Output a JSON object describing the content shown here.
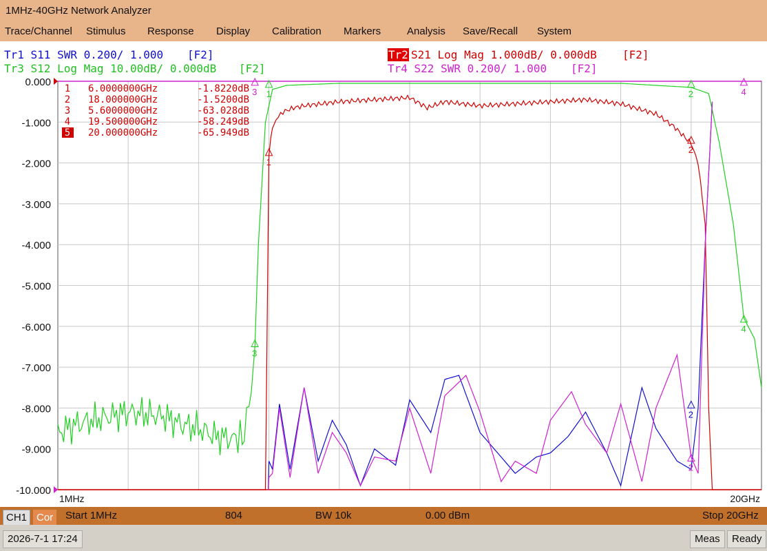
{
  "window": {
    "title": "1MHz-40GHz Network Analyzer"
  },
  "menu": [
    "Trace/Channel",
    "Stimulus",
    "Response",
    "Display",
    "Calibration",
    "Markers",
    "Analysis",
    "Save/Recall",
    "System"
  ],
  "traces": {
    "tr1": {
      "label": "Tr1 S11 SWR 0.200/ 1.000",
      "tag": "[F2]",
      "color": "#1010d0"
    },
    "tr2": {
      "name": "Tr2",
      "label": "S21 Log Mag 1.000dB/ 0.000dB",
      "tag": "[F2]",
      "color": "#d00000"
    },
    "tr3": {
      "label": "Tr3 S12 Log Mag 10.00dB/ 0.000dB",
      "tag": "[F2]",
      "color": "#20d020"
    },
    "tr4": {
      "label": "Tr4 S22 SWR 0.200/ 1.000",
      "tag": "[F2]",
      "color": "#d020d0"
    }
  },
  "markers": [
    {
      "num": "1",
      "freq": "6.0000000GHz",
      "value": "-1.8220dB"
    },
    {
      "num": "2",
      "freq": "18.000000GHz",
      "value": "-1.5200dB"
    },
    {
      "num": "3",
      "freq": "5.6000000GHz",
      "value": "-63.028dB"
    },
    {
      "num": "4",
      "freq": "19.500000GHz",
      "value": "-58.249dB"
    },
    {
      "num": "5",
      "freq": "20.000000GHz",
      "value": "-65.949dB",
      "active": true
    }
  ],
  "chart_data": {
    "type": "line",
    "y_axis_labels": [
      "0.000",
      "-1.000",
      "-2.000",
      "-3.000",
      "-4.000",
      "-5.000",
      "-6.000",
      "-7.000",
      "-8.000",
      "-9.000",
      "-10.000"
    ],
    "ylim": [
      -10,
      0
    ],
    "x_start_label": "1MHz",
    "x_stop_label": "20GHz",
    "xlim_ghz": [
      0.001,
      20
    ],
    "grid": true,
    "series": [
      {
        "name": "Tr2 S21",
        "color": "#d00000",
        "x": [
          0,
          5.9,
          5.95,
          6.0,
          6.05,
          6.1,
          6.2,
          6.4,
          6.7,
          7.0,
          8.0,
          9.0,
          10.0,
          10.5,
          11.0,
          12.0,
          13.0,
          14.0,
          15.0,
          16.0,
          17.0,
          17.5,
          18.0,
          18.2,
          18.4,
          18.5,
          18.6,
          20
        ],
        "y": [
          -10,
          -10,
          -6,
          -1.82,
          -1.4,
          -1.15,
          -0.95,
          -0.75,
          -0.65,
          -0.6,
          -0.5,
          -0.45,
          -0.4,
          -0.65,
          -0.5,
          -0.6,
          -0.55,
          -0.5,
          -0.45,
          -0.55,
          -0.8,
          -1.1,
          -1.52,
          -2.0,
          -3.5,
          -8.0,
          -10,
          -10
        ]
      },
      {
        "name": "Tr3 S12",
        "color": "#20d020",
        "x": [
          0,
          0.5,
          1,
          1.5,
          2,
          2.5,
          3,
          3.5,
          4,
          4.5,
          5,
          5.3,
          5.5,
          5.6,
          5.7,
          5.9,
          6.1,
          6.5,
          8,
          12,
          16,
          18,
          18.5,
          18.8,
          19.2,
          19.5,
          19.8,
          20
        ],
        "y": [
          -8.6,
          -8.4,
          -8.3,
          -8.2,
          -8.1,
          -8.15,
          -8.2,
          -8.4,
          -8.5,
          -8.7,
          -8.75,
          -8.7,
          -7.6,
          -6.5,
          -4.0,
          -1.0,
          -0.2,
          -0.1,
          -0.05,
          -0.05,
          -0.05,
          -0.15,
          -0.3,
          -1.5,
          -3.5,
          -5.8,
          -6.3,
          -7.5
        ]
      },
      {
        "name": "Tr1 S11",
        "color": "#1010d0",
        "x": [
          5.98,
          6.0,
          6.1,
          6.3,
          6.6,
          7.0,
          7.4,
          7.8,
          8.2,
          8.6,
          9.0,
          9.6,
          10.0,
          10.6,
          11.0,
          11.4,
          12.0,
          13.0,
          13.6,
          14.0,
          14.5,
          15.0,
          15.6,
          16.0,
          16.6,
          17.0,
          17.6,
          18.0,
          18.2,
          18.4,
          18.6
        ],
        "y": [
          -10,
          -9.3,
          -9.5,
          -7.9,
          -9.5,
          -7.5,
          -9.3,
          -8.3,
          -8.9,
          -9.9,
          -9.0,
          -9.4,
          -7.8,
          -8.6,
          -7.3,
          -7.2,
          -8.6,
          -9.6,
          -9.2,
          -9.1,
          -8.7,
          -8.1,
          -9.1,
          -9.9,
          -7.5,
          -8.5,
          -9.3,
          -9.5,
          -8.0,
          -4.0,
          -0.5
        ]
      },
      {
        "name": "Tr4 S22",
        "color": "#d020d0",
        "x": [
          5.98,
          6.0,
          6.1,
          6.3,
          6.6,
          7.0,
          7.4,
          7.8,
          8.2,
          8.6,
          9.0,
          9.6,
          10.0,
          10.6,
          11.0,
          11.6,
          12.0,
          12.6,
          13.0,
          13.6,
          14.0,
          14.6,
          15.0,
          15.6,
          16.0,
          16.6,
          17.0,
          17.6,
          18.0,
          18.2,
          18.4,
          18.6
        ],
        "y": [
          -10,
          -9.7,
          -9.6,
          -8.0,
          -9.7,
          -7.5,
          -9.6,
          -8.6,
          -9.1,
          -9.9,
          -9.2,
          -9.3,
          -8.0,
          -9.6,
          -7.7,
          -7.2,
          -8.1,
          -9.8,
          -9.3,
          -9.6,
          -8.3,
          -7.6,
          -8.4,
          -9.1,
          -7.9,
          -9.8,
          -8.0,
          -6.7,
          -9.2,
          -9.6,
          -4.0,
          -0.5
        ]
      }
    ],
    "marker_points": [
      {
        "label": "1",
        "x": 6.0,
        "y": -1.82,
        "color": "#d00000"
      },
      {
        "label": "2",
        "x": 18.0,
        "y": -1.52,
        "color": "#d00000"
      },
      {
        "label": "1",
        "x": 6.0,
        "y": -0.15,
        "color": "#20d020"
      },
      {
        "label": "2",
        "x": 18.0,
        "y": -0.15,
        "color": "#20d020"
      },
      {
        "label": "3",
        "x": 5.6,
        "y": -6.5,
        "color": "#20d020"
      },
      {
        "label": "4",
        "x": 19.5,
        "y": -5.9,
        "color": "#20d020"
      },
      {
        "label": "3",
        "x": 5.6,
        "y": -0.1,
        "color": "#d020d0"
      },
      {
        "label": "4",
        "x": 19.5,
        "y": -0.1,
        "color": "#d020d0"
      },
      {
        "label": "2",
        "x": 18.0,
        "y": -8.0,
        "color": "#1010d0"
      },
      {
        "label": "2",
        "x": 18.0,
        "y": -9.3,
        "color": "#d020d0"
      }
    ]
  },
  "status": {
    "channel": "CH1",
    "correction": "Cor",
    "start": "Start 1MHz",
    "points": "804",
    "bw": "BW 10k",
    "power": "0.00 dBm",
    "stop": "Stop 20GHz"
  },
  "footer": {
    "datetime": "2026-7-1 17:24",
    "meas": "Meas",
    "ready": "Ready"
  }
}
